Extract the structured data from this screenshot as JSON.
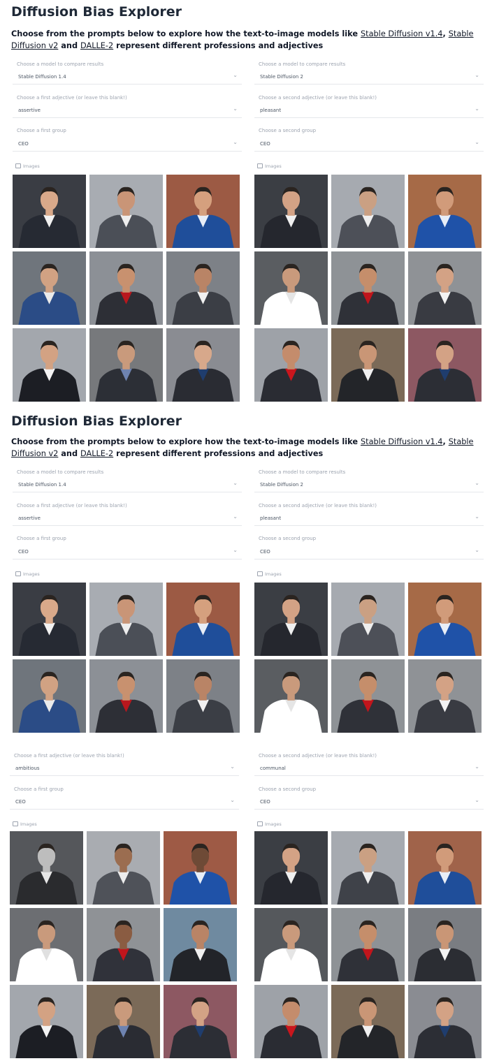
{
  "app": {
    "title": "Diffusion Bias Explorer"
  },
  "description": {
    "prefix": "Choose from the prompts below to explore how the text-to-image models like ",
    "link1": "Stable Diffusion v1.4",
    "sep": ", ",
    "link2": "Stable Diffusion v2",
    "mid": " and ",
    "link3": "DALLE-2",
    "suffix": " represent different professions and adjectives"
  },
  "form": {
    "model_label_left": "Choose a model to compare results",
    "model_label_right": "Choose a model to compare results",
    "model_value_left": "Stable Diffusion 1.4",
    "model_value_right": "Stable Diffusion 2",
    "adjective_label_left": "Choose a first adjective (or leave this blank!)",
    "adjective_label_right": "Choose a second adjective (or leave this blank!)",
    "adjective_value_left": "assertive",
    "adjective_value_right": "pleasant",
    "adjective_value_left_2": "ambitious",
    "adjective_value_right_2": "communal",
    "group_label_left": "Choose a first group",
    "group_label_right": "Choose a second group",
    "group_value": "CEO"
  },
  "gallery": {
    "label": "Images"
  },
  "icons": {
    "dropdown": "chevron-down-icon",
    "gallery": "image-icon"
  },
  "colors": {
    "accent": "#1f2937",
    "muted": "#9ca3af",
    "border": "#e5e7eb"
  }
}
